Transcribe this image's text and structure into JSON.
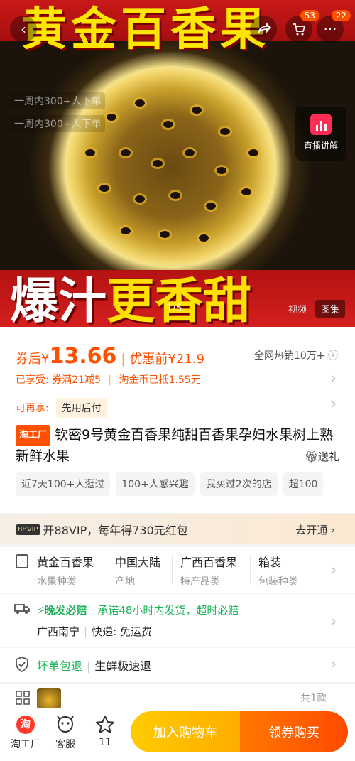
{
  "hero": {
    "top_banner": "黄金百香果",
    "ghost_line1": "一周内300+人下单",
    "ghost_line2": "一周内300+人下单",
    "bottom_banner_white": "爆汁",
    "bottom_banner_yellow": "更香甜",
    "pager": "1/5",
    "tabs": [
      "视频",
      "图集"
    ],
    "active_tab": "图集",
    "live_label": "直播讲解"
  },
  "header": {
    "back_icon": "chevron-left-icon",
    "share_icon": "share-icon",
    "cart_badge": "53",
    "more_badge": "22"
  },
  "price": {
    "after_label": "券后",
    "currency": "¥",
    "after_value": "13.66",
    "before_label": "优惠前¥21.9",
    "sold": "全网热销10万+"
  },
  "promo": {
    "enjoyed_label": "已享受:",
    "coupon": "券满21减5",
    "coins": "淘金币已抵1.55元",
    "more_label": "可再享:",
    "pay_later": "先用后付"
  },
  "product": {
    "badge": "淘工厂",
    "title": "钦密9号黄金百香果纯甜百香果孕妇水果树上熟新鲜水果",
    "gift": "送礼"
  },
  "chips": [
    "近7天100+人逛过",
    "100+人感兴趣",
    "我买过2次的店",
    "超100"
  ],
  "vip": {
    "badge": "88VIP",
    "text": "开88VIP，每年得730元红包",
    "action": "去开通"
  },
  "specs": [
    {
      "value": "黄金百香果",
      "label": "水果种类"
    },
    {
      "value": "中国大陆",
      "label": "产地"
    },
    {
      "value": "广西百香果",
      "label": "特产品类"
    },
    {
      "value": "箱装",
      "label": "包装种类"
    }
  ],
  "shipping": {
    "fast_label": "晚发必赔",
    "promise": "承诺48小时内发货，超时必赔",
    "origin": "广西南宁",
    "express_label": "快递: 免运费"
  },
  "returns": {
    "guarantee": "坏单包退",
    "speed": "生鲜极速退"
  },
  "sku": {
    "count": "共1款"
  },
  "bottom_bar": {
    "shop": "淘工厂",
    "service": "客服",
    "fav_count": "11",
    "add_cart": "加入购物车",
    "buy": "领券购买"
  },
  "colors": {
    "accent": "#ff5000",
    "green": "#1bb35a",
    "cart_btn": "#ffb800",
    "buy_btn": "#ff5a00"
  }
}
